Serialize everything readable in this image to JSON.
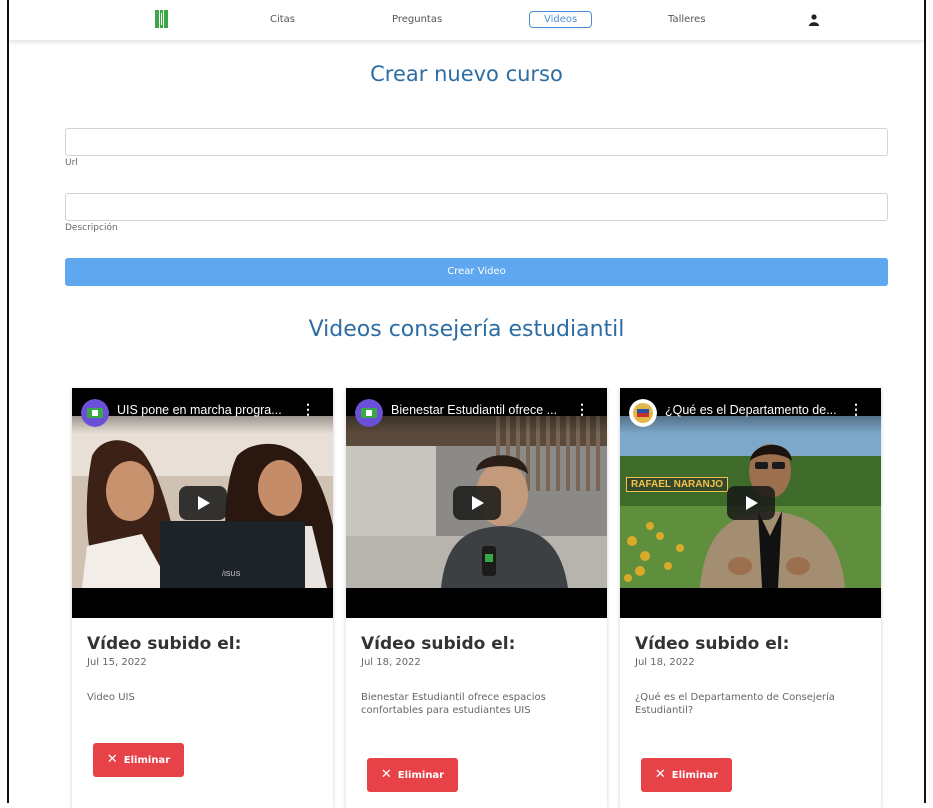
{
  "nav": {
    "items": [
      "Citas",
      "Preguntas",
      "Videos",
      "Talleres"
    ],
    "active": "Videos"
  },
  "form": {
    "title": "Crear nuevo curso",
    "url_label": "Url",
    "url_value": "",
    "description_label": "Descripción",
    "description_value": "",
    "submit_label": "Crear Video"
  },
  "videos_section_title": "Videos consejería estudiantil",
  "videos": [
    {
      "video_title": "UIS pone en marcha progra...",
      "card_title": "Vídeo subido el:",
      "date": "Jul 15, 2022",
      "description": "Video UIS",
      "delete_label": "Eliminar"
    },
    {
      "video_title": "Bienestar Estudiantil ofrece ...",
      "card_title": "Vídeo subido el:",
      "date": "Jul 18, 2022",
      "description": "Bienestar Estudiantil ofrece espacios confortables para estudiantes UIS",
      "delete_label": "Eliminar"
    },
    {
      "video_title": "¿Qué es el Departamento de...",
      "card_title": "Vídeo subido el:",
      "date": "Jul 18, 2022",
      "description": "¿Qué es el Departamento de Consejería Estudiantil?",
      "delete_label": "Eliminar",
      "overlay_name": "RAFAEL NARANJO"
    }
  ],
  "colors": {
    "heading": "#2e6da4",
    "primary_button": "#5fa7ef",
    "danger_button": "#e74248",
    "logo_green": "#3aa845"
  },
  "icons": {
    "logo": "uis-logo-icon",
    "user": "user-icon",
    "play": "play-icon",
    "menu": "more-vert-icon",
    "delete": "close-icon"
  }
}
